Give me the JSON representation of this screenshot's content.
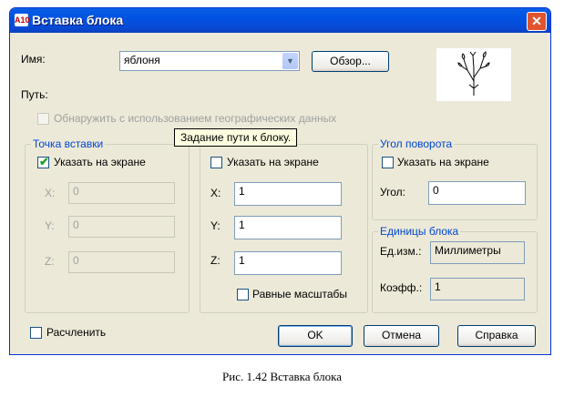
{
  "window": {
    "title": "Вставка блока",
    "app_icon": "A10",
    "close": "✕"
  },
  "name_field": {
    "label": "Имя:",
    "value": "яблоня"
  },
  "browse_button": "Обзор...",
  "path_label": "Путь:",
  "geo_checkbox": {
    "label": "Обнаружить с использованием географических данных",
    "checked": false,
    "enabled": false
  },
  "tooltip": "Задание пути к блоку.",
  "insertion_point": {
    "title": "Точка вставки",
    "on_screen": {
      "label": "Указать на экране",
      "checked": true
    },
    "x": {
      "label": "X:",
      "value": "0"
    },
    "y": {
      "label": "Y:",
      "value": "0"
    },
    "z": {
      "label": "Z:",
      "value": "0"
    }
  },
  "scale": {
    "on_screen": {
      "label": "Указать на экране",
      "checked": false
    },
    "x": {
      "label": "X:",
      "value": "1"
    },
    "y": {
      "label": "Y:",
      "value": "1"
    },
    "z": {
      "label": "Z:",
      "value": "1"
    },
    "uniform": {
      "label": "Равные масштабы",
      "checked": false
    }
  },
  "rotation": {
    "title": "Угол поворота",
    "on_screen": {
      "label": "Указать на экране",
      "checked": false
    },
    "angle": {
      "label": "Угол:",
      "value": "0"
    }
  },
  "block_units": {
    "title": "Единицы блока",
    "unit": {
      "label": "Ед.изм.:",
      "value": "Миллиметры"
    },
    "factor": {
      "label": "Коэфф.:",
      "value": "1"
    }
  },
  "explode": {
    "label": "Расчленить",
    "checked": false
  },
  "buttons": {
    "ok": "OK",
    "cancel": "Отмена",
    "help": "Справка"
  },
  "caption": "Рис. 1.42 Вставка блока",
  "icons": {
    "dropdown": "chevron-down-icon",
    "check": "checkmark-icon",
    "close": "close-icon",
    "preview": "tree-block-preview"
  },
  "colors": {
    "title_bar": "#0a5ee6",
    "group_title": "#0046d5",
    "dialog_bg": "#ece9d8",
    "check": "#21a121"
  }
}
